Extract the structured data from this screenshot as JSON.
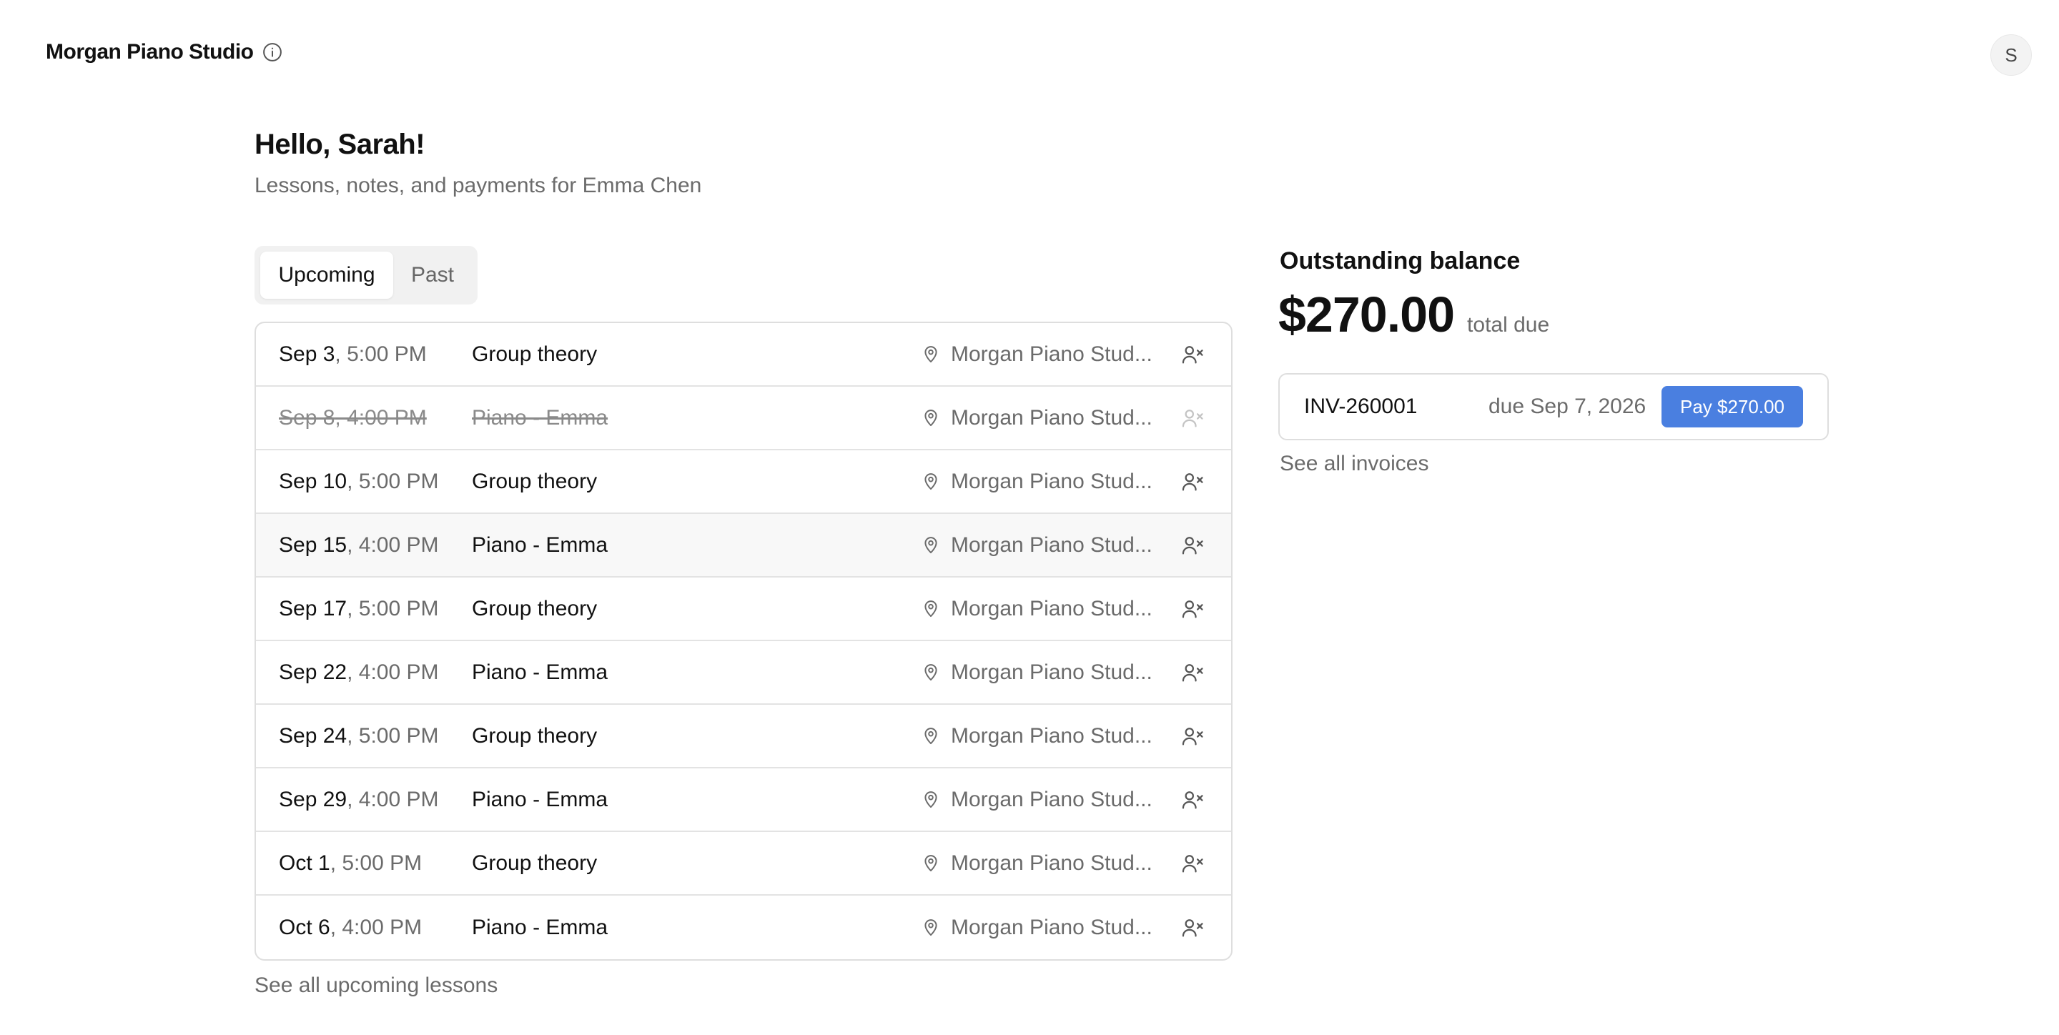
{
  "header": {
    "brand": "Morgan Piano Studio",
    "avatar_initial": "S"
  },
  "greeting": {
    "title": "Hello, Sarah!",
    "subtitle": "Lessons, notes, and payments for Emma Chen"
  },
  "tabs": [
    {
      "label": "Upcoming",
      "active": true
    },
    {
      "label": "Past",
      "active": false
    }
  ],
  "lessons": [
    {
      "day": "Sep 3",
      "time": ", 5:00 PM",
      "title": "Group theory",
      "location": "Morgan Piano Stud...",
      "cancelled": false
    },
    {
      "day": "Sep 8",
      "time": ", 4:00 PM",
      "title": "Piano - Emma",
      "location": "Morgan Piano Stud...",
      "cancelled": true
    },
    {
      "day": "Sep 10",
      "time": ", 5:00 PM",
      "title": "Group theory",
      "location": "Morgan Piano Stud...",
      "cancelled": false
    },
    {
      "day": "Sep 15",
      "time": ", 4:00 PM",
      "title": "Piano - Emma",
      "location": "Morgan Piano Stud...",
      "cancelled": false
    },
    {
      "day": "Sep 17",
      "time": ", 5:00 PM",
      "title": "Group theory",
      "location": "Morgan Piano Stud...",
      "cancelled": false
    },
    {
      "day": "Sep 22",
      "time": ", 4:00 PM",
      "title": "Piano - Emma",
      "location": "Morgan Piano Stud...",
      "cancelled": false
    },
    {
      "day": "Sep 24",
      "time": ", 5:00 PM",
      "title": "Group theory",
      "location": "Morgan Piano Stud...",
      "cancelled": false
    },
    {
      "day": "Sep 29",
      "time": ", 4:00 PM",
      "title": "Piano - Emma",
      "location": "Morgan Piano Stud...",
      "cancelled": false
    },
    {
      "day": "Oct 1",
      "time": ", 5:00 PM",
      "title": "Group theory",
      "location": "Morgan Piano Stud...",
      "cancelled": false
    },
    {
      "day": "Oct 6",
      "time": ", 4:00 PM",
      "title": "Piano - Emma",
      "location": "Morgan Piano Stud...",
      "cancelled": false
    }
  ],
  "see_all_lessons": "See all upcoming lessons",
  "balance": {
    "title": "Outstanding balance",
    "amount": "$270.00",
    "amount_label": "total due"
  },
  "invoice": {
    "id": "INV-260001",
    "due": "due Sep 7, 2026",
    "pay_label": "Pay $270.00"
  },
  "see_all_invoices": "See all invoices",
  "colors": {
    "accent": "#4a7fe0",
    "muted_text": "#6b6b6b",
    "border": "#dedede"
  }
}
